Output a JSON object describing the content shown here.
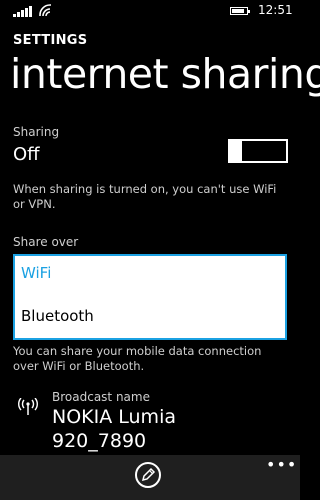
{
  "status": {
    "time": "12:51",
    "battery_level": 0.85
  },
  "header": {
    "app_title": "SETTINGS",
    "page_title": "internet sharing"
  },
  "sharing": {
    "label": "Sharing",
    "value": "Off",
    "note": "When sharing is turned on, you can't use WiFi or VPN."
  },
  "share_over": {
    "label": "Share over",
    "options": [
      "WiFi",
      "Bluetooth"
    ],
    "selected": "WiFi",
    "note": "You can share your mobile data connection over WiFi or Bluetooth."
  },
  "broadcast": {
    "label": "Broadcast name",
    "name": "NOKIA Lumia 920_7890"
  },
  "appbar": {
    "more": "•••",
    "accent": "#1ba1e2"
  }
}
